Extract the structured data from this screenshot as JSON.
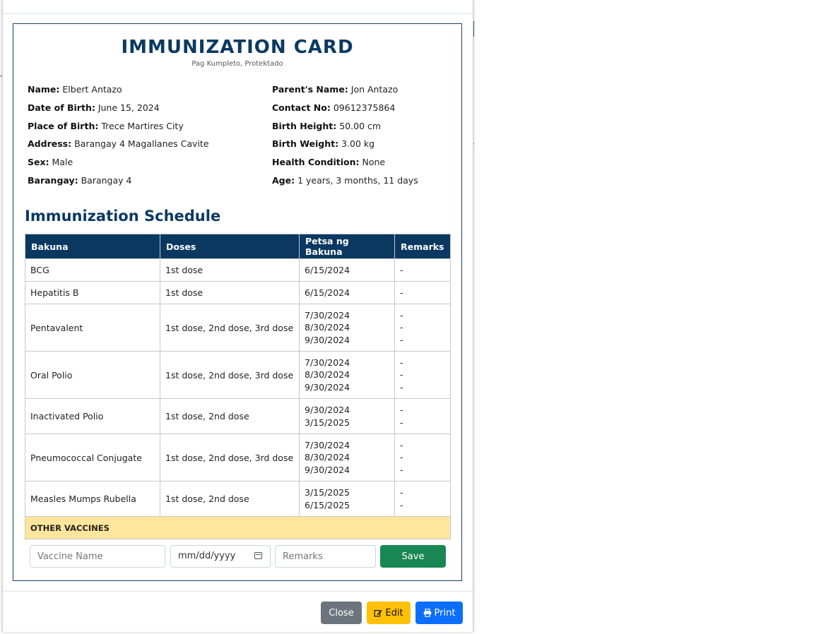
{
  "card": {
    "title": "IMMUNIZATION CARD",
    "subtitle": "Pag Kumpleto, Protektado"
  },
  "patient_left": [
    {
      "label": "Name:",
      "value": "Elbert Antazo"
    },
    {
      "label": "Date of Birth:",
      "value": "June 15, 2024"
    },
    {
      "label": "Place of Birth:",
      "value": "Trece Martires City"
    },
    {
      "label": "Address:",
      "value": "Barangay 4 Magallanes Cavite"
    },
    {
      "label": "Sex:",
      "value": "Male"
    },
    {
      "label": "Barangay:",
      "value": "Barangay 4"
    }
  ],
  "patient_right": [
    {
      "label": "Parent's Name:",
      "value": "Jon Antazo"
    },
    {
      "label": "Contact No:",
      "value": "09612375864"
    },
    {
      "label": "Birth Height:",
      "value": "50.00 cm"
    },
    {
      "label": "Birth Weight:",
      "value": "3.00 kg"
    },
    {
      "label": "Health Condition:",
      "value": "None"
    },
    {
      "label": "Age:",
      "value": "1 years, 3 months, 11 days"
    }
  ],
  "schedule": {
    "title": "Immunization Schedule",
    "headers": [
      "Bakuna",
      "Doses",
      "Petsa ng Bakuna",
      "Remarks"
    ],
    "rows": [
      {
        "vaccine": "BCG",
        "doses": "1st dose",
        "dates": [
          "6/15/2024"
        ],
        "remarks": [
          "-"
        ]
      },
      {
        "vaccine": "Hepatitis B",
        "doses": "1st dose",
        "dates": [
          "6/15/2024"
        ],
        "remarks": [
          "-"
        ]
      },
      {
        "vaccine": "Pentavalent",
        "doses": "1st dose, 2nd dose, 3rd dose",
        "dates": [
          "7/30/2024",
          "8/30/2024",
          "9/30/2024"
        ],
        "remarks": [
          "-",
          "-",
          "-"
        ]
      },
      {
        "vaccine": "Oral Polio",
        "doses": "1st dose, 2nd dose, 3rd dose",
        "dates": [
          "7/30/2024",
          "8/30/2024",
          "9/30/2024"
        ],
        "remarks": [
          "-",
          "-",
          "-"
        ]
      },
      {
        "vaccine": "Inactivated Polio",
        "doses": "1st dose, 2nd dose",
        "dates": [
          "9/30/2024",
          "3/15/2025"
        ],
        "remarks": [
          "-",
          "-"
        ]
      },
      {
        "vaccine": "Pneumococcal Conjugate",
        "doses": "1st dose, 2nd dose, 3rd dose",
        "dates": [
          "7/30/2024",
          "8/30/2024",
          "9/30/2024"
        ],
        "remarks": [
          "-",
          "-",
          "-"
        ]
      },
      {
        "vaccine": "Measles Mumps Rubella",
        "doses": "1st dose, 2nd dose",
        "dates": [
          "3/15/2025",
          "6/15/2025"
        ],
        "remarks": [
          "-",
          "-"
        ]
      }
    ],
    "other_label": "OTHER VACCINES"
  },
  "form": {
    "vaccine_placeholder": "Vaccine Name",
    "date_value": "mm/dd/yyyy",
    "remarks_placeholder": "Remarks",
    "save_label": "Save"
  },
  "footer": {
    "close_label": "Close",
    "edit_label": "Edit",
    "print_label": "Print"
  },
  "colors": {
    "header_navy": "#0b3861",
    "title_navy": "#0b3a63",
    "other_row": "#ffe69c",
    "save_green": "#198754",
    "close_gray": "#6c757d",
    "edit_yellow": "#ffc107",
    "print_blue": "#0d6efd"
  },
  "icons": {
    "edit": "pencil-square-icon",
    "print": "printer-icon",
    "date": "calendar-icon"
  }
}
